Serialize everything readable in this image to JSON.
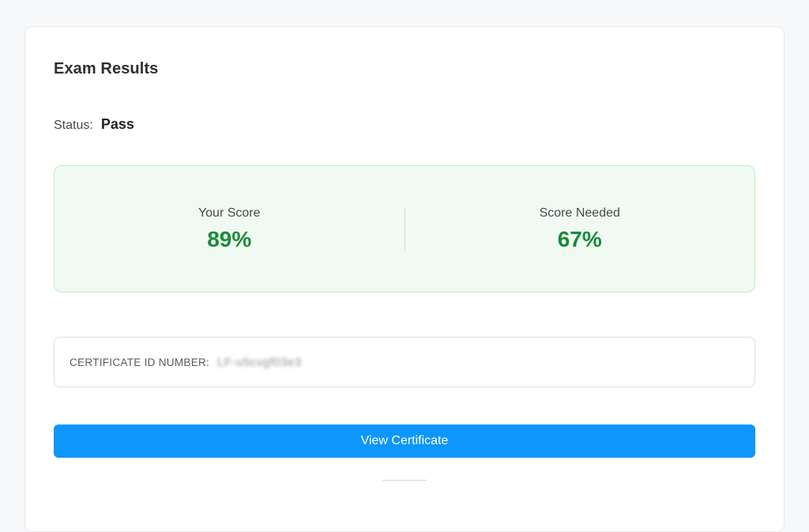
{
  "results": {
    "title": "Exam Results",
    "status_label": "Status:",
    "status_value": "Pass",
    "score": {
      "your_label": "Your Score",
      "your_value": "89%",
      "needed_label": "Score Needed",
      "needed_value": "67%"
    },
    "certificate": {
      "label": "CERTIFICATE ID NUMBER:",
      "value": "LF-u5cvgf03e3"
    },
    "view_button_label": "View Certificate"
  },
  "colors": {
    "accent": "#0d96fb",
    "pass_green": "#1b8a3a",
    "panel_bg": "#f0faf2",
    "panel_border": "#bfeccb"
  }
}
